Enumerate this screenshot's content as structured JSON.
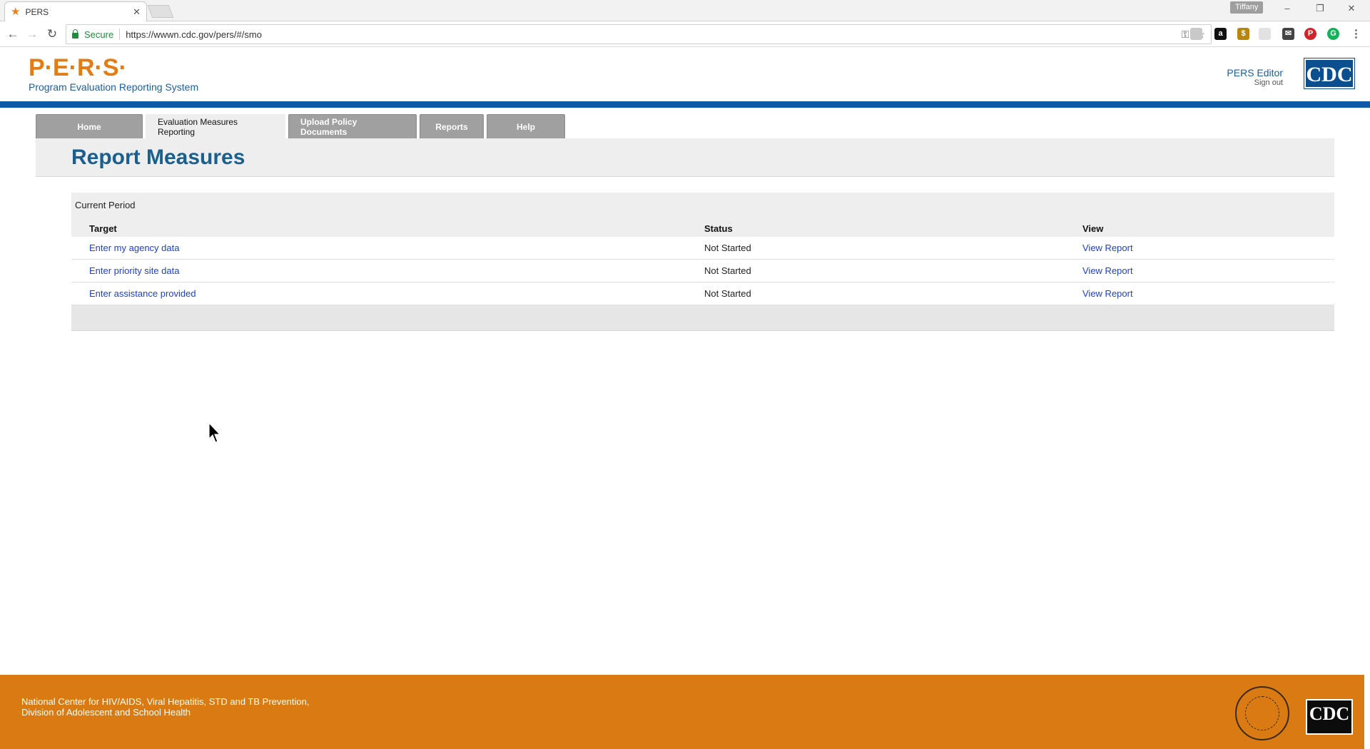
{
  "browser": {
    "tab_title": "PERS",
    "profile": "Tiffany",
    "secure_label": "Secure",
    "url": "https://wwwn.cdc.gov/pers/#/smo"
  },
  "header": {
    "logo_text": "P·E·R·S·",
    "logo_subtitle": "Program Evaluation Reporting System",
    "user_name": "PERS Editor",
    "signout": "Sign out",
    "cdc_logo": "CDC"
  },
  "nav": {
    "tabs": [
      {
        "label": "Home",
        "active": false
      },
      {
        "label": "Evaluation Measures Reporting",
        "active": true
      },
      {
        "label": "Upload Policy Documents",
        "active": false
      },
      {
        "label": "Reports",
        "active": false
      },
      {
        "label": "Help",
        "active": false
      }
    ]
  },
  "main": {
    "title": "Report Measures",
    "period": "Current Period",
    "columns": [
      "Target",
      "Status",
      "View"
    ],
    "rows": [
      {
        "target": "Enter my agency data",
        "status": "Not Started",
        "view": "View Report"
      },
      {
        "target": "Enter priority site data",
        "status": "Not Started",
        "view": "View Report"
      },
      {
        "target": "Enter assistance provided",
        "status": "Not Started",
        "view": "View Report"
      }
    ]
  },
  "footer": {
    "line1": "National Center for HIV/AIDS, Viral Hepatitis, STD and TB Prevention,",
    "line2": "Division of Adolescent and School Health",
    "cdc_logo": "CDC"
  },
  "colors": {
    "accent_blue": "#0d5aa7",
    "logo_orange": "#e27d15",
    "footer_orange": "#d97b12",
    "link_blue": "#1b3fd1"
  }
}
